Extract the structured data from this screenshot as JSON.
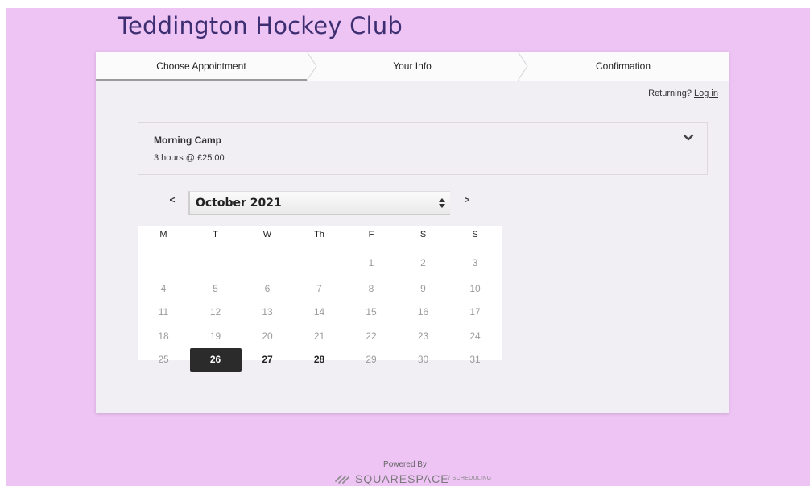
{
  "header": {
    "club_title": "Teddington Hockey Club"
  },
  "steps": [
    {
      "label": "Choose Appointment",
      "active": true
    },
    {
      "label": "Your Info",
      "active": false
    },
    {
      "label": "Confirmation",
      "active": false
    }
  ],
  "returning": {
    "prompt": "Returning?",
    "link": "Log in"
  },
  "appointment": {
    "name": "Morning Camp",
    "detail": "3 hours @ £25.00",
    "chevron_icon": "chevron-down-icon"
  },
  "calendar": {
    "prev_label": "<",
    "next_label": ">",
    "month_label": "October 2021",
    "weekdays": [
      "M",
      "T",
      "W",
      "Th",
      "F",
      "S",
      "S"
    ],
    "weeks": [
      [
        "",
        "",
        "",
        "",
        "1",
        "2",
        "3"
      ],
      [
        "4",
        "5",
        "6",
        "7",
        "8",
        "9",
        "10"
      ],
      [
        "11",
        "12",
        "13",
        "14",
        "15",
        "16",
        "17"
      ],
      [
        "18",
        "19",
        "20",
        "21",
        "22",
        "23",
        "24"
      ],
      [
        "25",
        "26",
        "27",
        "28",
        "29",
        "30",
        "31"
      ]
    ],
    "available_days": [
      "26",
      "27",
      "28"
    ],
    "selected_day": "26"
  },
  "footer": {
    "powered_by": "Powered By",
    "brand": "SQUARESPACE",
    "product": "/ SCHEDULING"
  },
  "colors": {
    "background": "#eec4f5",
    "title": "#3d2e72",
    "selected_day": "#2b2b2b"
  }
}
